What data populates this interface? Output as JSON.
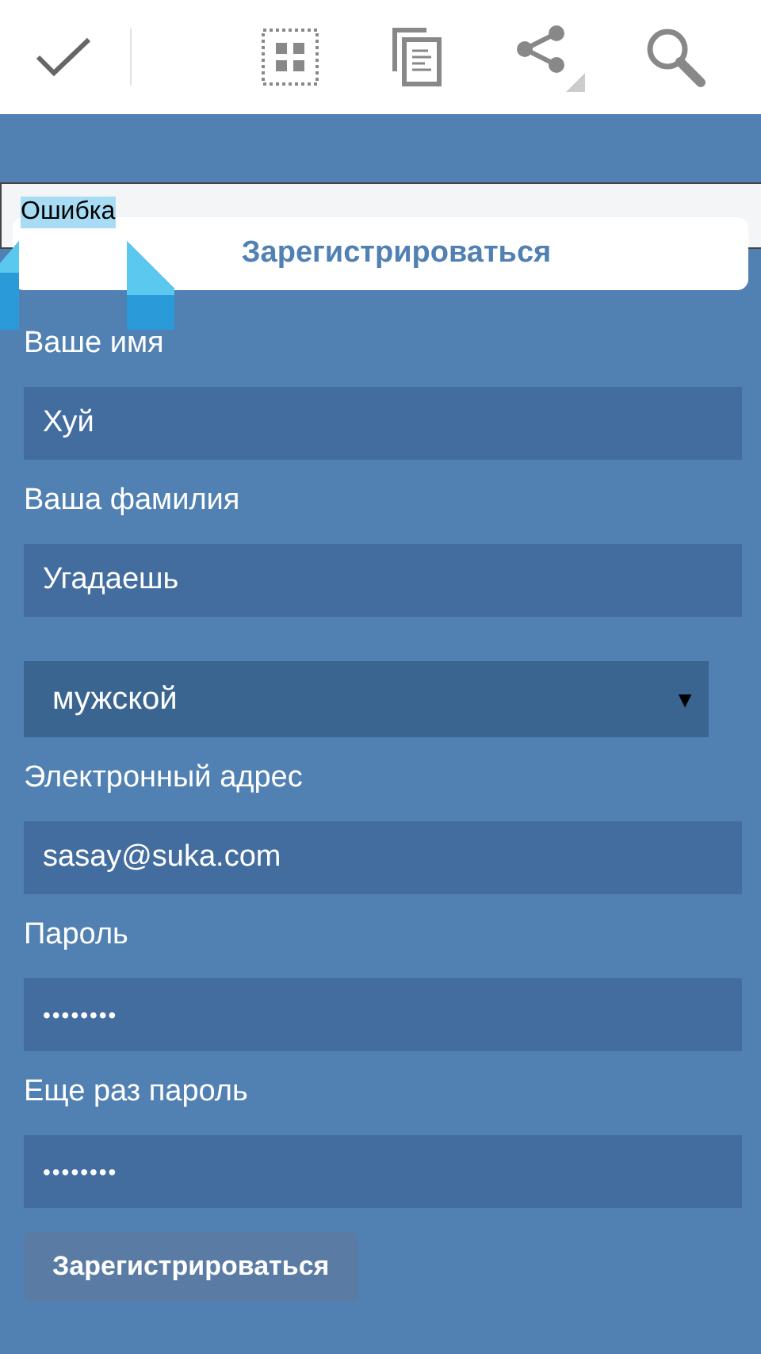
{
  "error": {
    "text": "Ошибка",
    "selected": true
  },
  "header": {
    "title": "Зарегистрироваться"
  },
  "fields": [
    {
      "kind": "text",
      "label": "Ваше имя",
      "value": "Хуй"
    },
    {
      "kind": "text",
      "label": "Ваша фамилия",
      "value": "Угадаешь"
    },
    {
      "kind": "select",
      "value": "мужской",
      "arrow": "▼"
    },
    {
      "kind": "text",
      "label": "Электронный адрес",
      "value": "sasay@suka.com"
    },
    {
      "kind": "password",
      "label": "Пароль",
      "value": "••••••••"
    },
    {
      "kind": "password",
      "label": "Еще раз пароль",
      "value": "••••••••"
    }
  ],
  "submit": {
    "label": "Зарегистрироваться"
  }
}
